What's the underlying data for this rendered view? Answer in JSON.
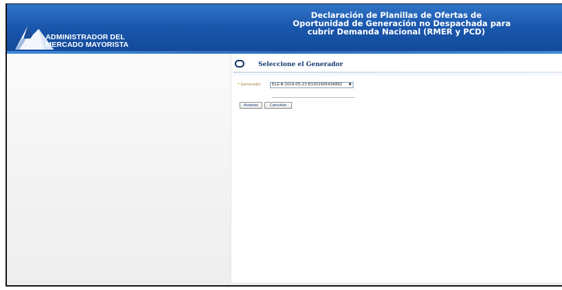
{
  "header": {
    "logo": {
      "icon": "mountain-logo-icon",
      "line1": "ADMINISTRADOR DEL",
      "line2": "MERCADO MAYORISTA"
    },
    "title_lines": [
      "Declaración de Planillas de Ofertas de",
      "Oportunidad de Generación no Despachada para",
      "cubrir Demanda Nacional (RMER y PCD)"
    ]
  },
  "form": {
    "section_icon": "rounded-rect-icon",
    "section_title": "Seleccione el Generador",
    "generator": {
      "required_mark": "*",
      "label": "Generador",
      "selected": "ELG-B 2019-05-23 EO201905436882"
    },
    "buttons": {
      "accept": "Aceptar",
      "cancel": "Cancelar"
    }
  },
  "colors": {
    "header_blue": "#1a57ad",
    "title_navy": "#163c72"
  }
}
